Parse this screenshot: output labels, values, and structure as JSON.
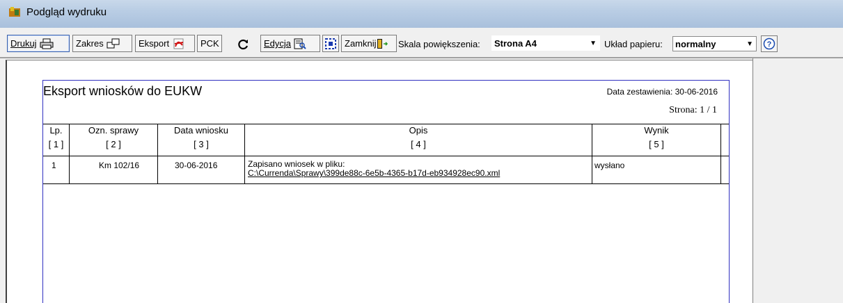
{
  "window": {
    "title": "Podgląd wydruku"
  },
  "toolbar": {
    "print_label": "Drukuj",
    "range_label": "Zakres",
    "export_label": "Eksport",
    "pck_label": "PCK",
    "edit_label": "Edycja",
    "close_label": "Zamknij",
    "zoom_label": "Skala powiększenia:",
    "zoom_value": "Strona A4",
    "paper_label": "Układ papieru:",
    "paper_value": "normalny"
  },
  "report": {
    "title": "Eksport wniosków do EUKW",
    "date_line": "Data zestawienia: 30-06-2016",
    "page_line": "Strona: 1 / 1",
    "columns": [
      {
        "name": "Lp.",
        "index": "[ 1 ]"
      },
      {
        "name": "Ozn. sprawy",
        "index": "[ 2 ]"
      },
      {
        "name": "Data wniosku",
        "index": "[ 3 ]"
      },
      {
        "name": "Opis",
        "index": "[ 4 ]"
      },
      {
        "name": "Wynik",
        "index": "[ 5 ]"
      }
    ],
    "rows": [
      {
        "lp": "1",
        "sprawa": "Km 102/16",
        "data": "30-06-2016",
        "opis_1": "Zapisano wniosek w pliku:",
        "opis_2": "C:\\Currenda\\Sprawy\\399de88c-6e5b-4365-b17d-eb934928ec90.xml",
        "wynik": "wysłano"
      }
    ]
  }
}
